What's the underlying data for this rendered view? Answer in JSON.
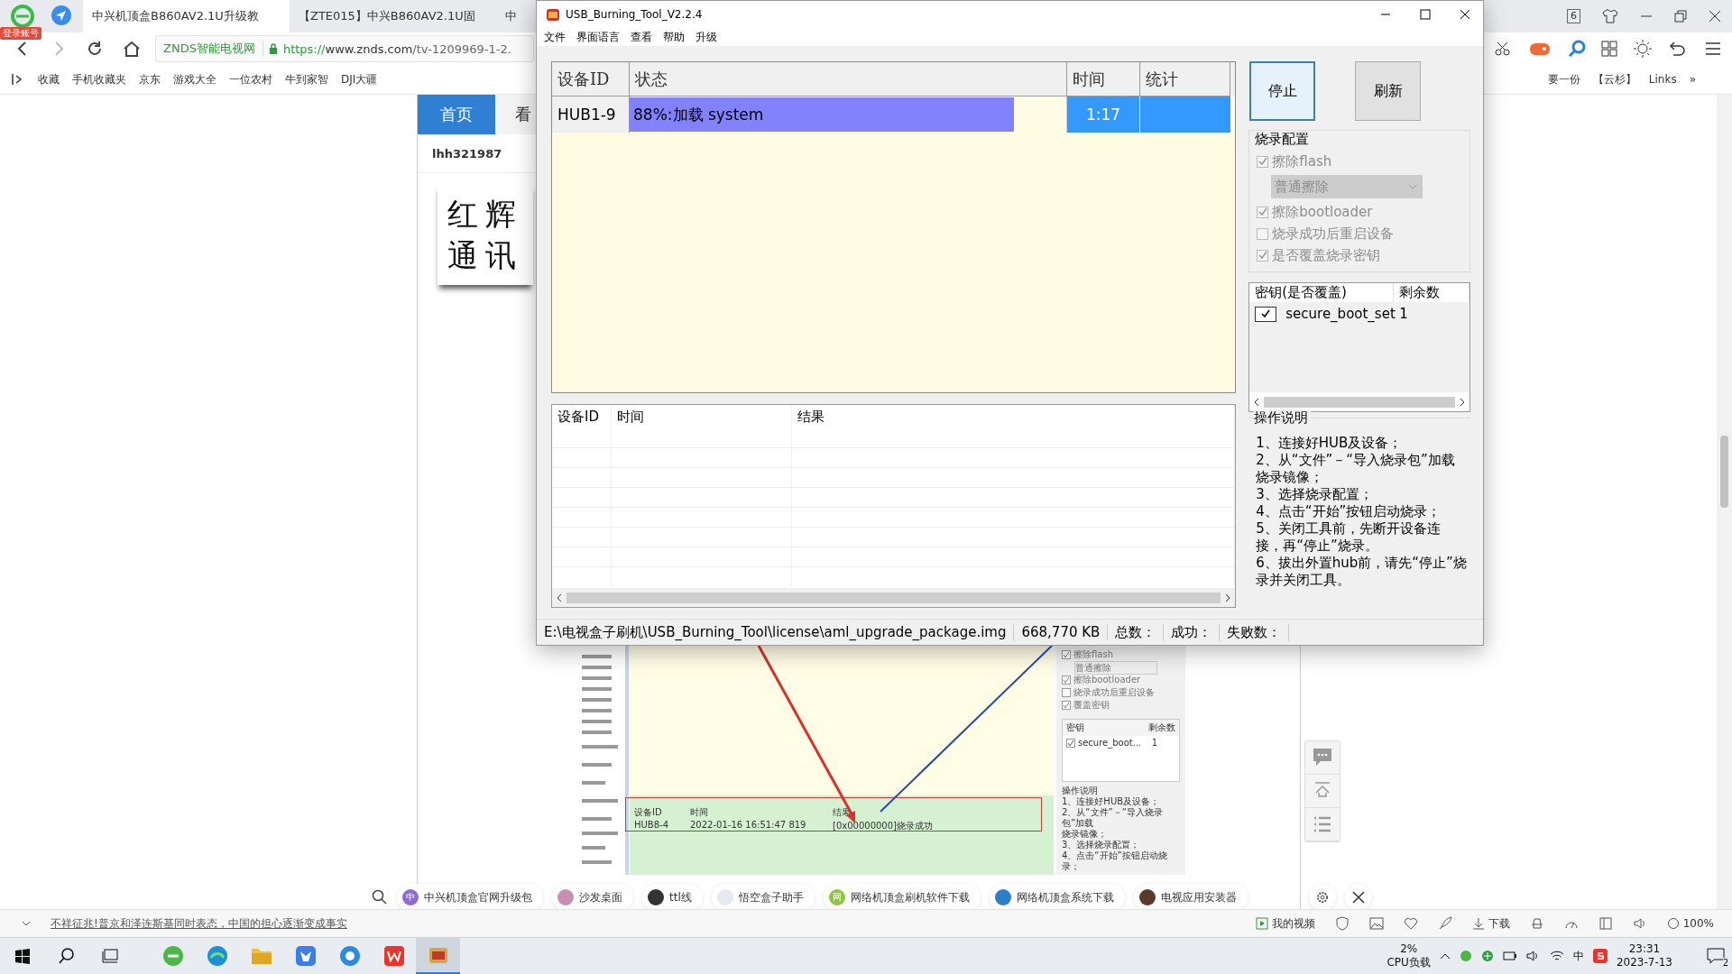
{
  "browser": {
    "login_badge": "登录账号",
    "tabs": [
      {
        "label": "中兴机顶盒B860AV2.1U升级教",
        "selected": true
      },
      {
        "label": "【ZTE015】中兴B860AV2.1U固",
        "selected": false
      },
      {
        "label": "中",
        "selected": false
      }
    ],
    "tab_count": "6",
    "address": {
      "site": "ZNDS智能电视网",
      "scheme": "https://",
      "host": "www.znds.com",
      "path": "/tv-1209969-1-2."
    },
    "bookmarks": [
      {
        "label": "收藏"
      },
      {
        "label": "手机收藏夹"
      },
      {
        "label": "京东"
      },
      {
        "label": "游戏大全"
      },
      {
        "label": "一位农村"
      },
      {
        "label": "牛到家智"
      },
      {
        "label": "DJI大疆"
      }
    ],
    "bookmarks_right": [
      {
        "label": "要一份"
      },
      {
        "label": "【云杉】"
      },
      {
        "label": "Links"
      }
    ],
    "more": "»"
  },
  "page": {
    "nav": [
      {
        "label": "首页",
        "selected": true
      },
      {
        "label": "看",
        "selected": false
      }
    ],
    "username": "lhh321987",
    "logo_lines": [
      "红辉",
      "通讯"
    ],
    "article_screenshot": {
      "config": [
        {
          "kind": "checkbox",
          "label": "擦除flash",
          "checked": true
        },
        {
          "kind": "select",
          "label": "普通擦除"
        },
        {
          "kind": "checkbox",
          "label": "擦除bootloader",
          "checked": true
        },
        {
          "kind": "checkbox",
          "label": "烧录成功后重启设备",
          "checked": false
        },
        {
          "kind": "checkbox",
          "label": "覆盖密钥",
          "checked": true
        }
      ],
      "key_columns": [
        "密钥",
        "剩余数"
      ],
      "key_row": [
        "secure_boot...",
        "1"
      ],
      "key_checked": true,
      "log_columns": [
        "设备ID",
        "时间",
        "结果"
      ],
      "log_row": [
        "HUB8-4",
        "2022-01-16 16:51:47 819",
        "[0x00000000]烧录成功"
      ],
      "help_title": "操作说明",
      "help_lines": [
        "1、连接好HUB及设备；",
        "2、从“文件”－“导入烧录包”加载",
        "烧录镜像；",
        "3、选择烧录配置；",
        "4、点击“开始”按钮启动烧录；"
      ]
    }
  },
  "search_bar": {
    "chips": [
      {
        "label": "中兴机顶盒官网升级包",
        "icon_text": "中",
        "color": "#8e6bd6"
      },
      {
        "label": "沙发桌面",
        "color": "#c98fb0"
      },
      {
        "label": "ttl线",
        "color": "#333333"
      },
      {
        "label": "悟空盒子助手",
        "color": "#e8e8f0"
      },
      {
        "label": "网络机顶盒刷机软件下载",
        "icon_text": "网",
        "color": "#8cc63f"
      },
      {
        "label": "网络机顶盒系统下载",
        "color": "#2a7fc9"
      },
      {
        "label": "电视应用安装器",
        "color": "#5a3a2a"
      }
    ]
  },
  "status_bar": {
    "news": "不祥征兆!普京和泽连斯基同时表态，中国的担心逐渐变成事实",
    "video": "我的视频",
    "download": "下载",
    "zoom": "100%"
  },
  "tool": {
    "title": "USB_Burning_Tool_V2.2.4",
    "menu": [
      "文件",
      "界面语言",
      "查看",
      "帮助",
      "升级"
    ],
    "device_columns": [
      "设备ID",
      "状态",
      "时间",
      "统计"
    ],
    "devices": [
      {
        "id": "HUB1-9",
        "status": "88%:加载 system",
        "level": 0.88,
        "time": "1:17"
      }
    ],
    "buttons": [
      {
        "label": "停止",
        "focused": true
      },
      {
        "label": "刷新",
        "focused": false
      }
    ],
    "config_title": "烧录配置",
    "config": [
      {
        "kind": "checkbox",
        "label": "擦除flash",
        "checked": true,
        "disabled": true
      },
      {
        "kind": "select",
        "label": "普通擦除",
        "disabled": true
      },
      {
        "kind": "checkbox",
        "label": "擦除bootloader",
        "checked": true,
        "disabled": true
      },
      {
        "kind": "checkbox",
        "label": "烧录成功后重启设备",
        "checked": false,
        "disabled": true
      },
      {
        "kind": "checkbox",
        "label": "是否覆盖烧录密钥",
        "checked": true,
        "disabled": true
      }
    ],
    "key_columns": [
      "密钥(是否覆盖)",
      "剩余数"
    ],
    "keys": [
      {
        "name": "secure_boot_set",
        "checked": true,
        "count": "1"
      }
    ],
    "help_title": "操作说明",
    "help_lines": [
      "1、连接好HUB及设备；",
      "2、从“文件”－“导入烧录包”加载烧录镜像；",
      "3、选择烧录配置；",
      "4、点击“开始”按钮启动烧录；",
      "5、关闭工具前，先断开设备连接，再“停止”烧录。",
      "6、拔出外置hub前，请先“停止”烧录并关闭工具。"
    ],
    "log_columns": [
      "设备ID",
      "时间",
      "结果"
    ],
    "status": [
      "E:\\电视盒子刷机\\USB_Burning_Tool\\license\\aml_upgrade_package.img",
      "668,770 KB",
      "总数：",
      "成功：",
      "失败数："
    ]
  },
  "taskbar": {
    "cpu": "2%",
    "cpu_label": "CPU负载",
    "ime": "中",
    "time": "23:31",
    "date": "2023-7-13",
    "notifications": "2"
  }
}
